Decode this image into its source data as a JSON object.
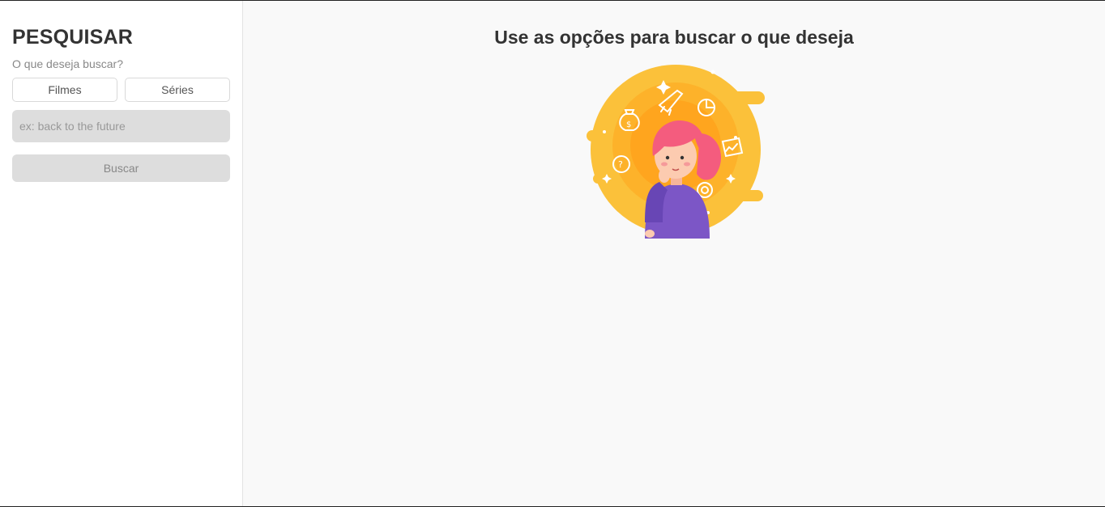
{
  "sidebar": {
    "title": "PESQUISAR",
    "subtitle": "O que deseja buscar?",
    "type_options": [
      "Filmes",
      "Séries"
    ],
    "search": {
      "placeholder": "ex: back to the future",
      "value": ""
    },
    "submit_label": "Buscar"
  },
  "main": {
    "heading": "Use as opções para buscar o que deseja",
    "illustration": "thinking-girl-illustration"
  },
  "colors": {
    "accent_yellow": "#FBC13A",
    "accent_orange": "#FFA51E",
    "hair_pink": "#F45C7E",
    "sweater_purple": "#7C56C6",
    "input_bg": "#DDDDDD"
  }
}
